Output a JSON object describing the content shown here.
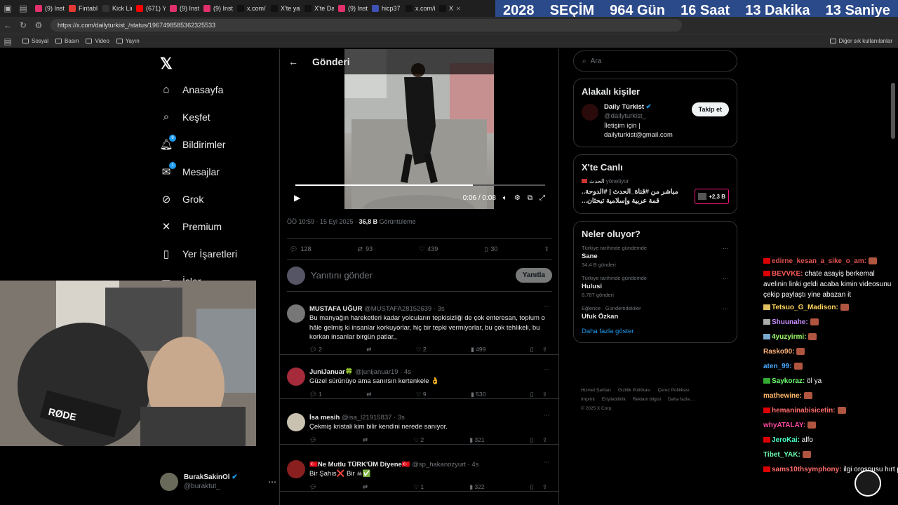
{
  "browser": {
    "tabs": [
      {
        "label": "(9) Inst",
        "color": "#e1306c"
      },
      {
        "label": "Fintabl",
        "color": "#e53935"
      },
      {
        "label": "Kick Lir",
        "color": "#333"
      },
      {
        "label": "(671) Y",
        "color": "#ff0000"
      },
      {
        "label": "(9) Inst",
        "color": "#e1306c"
      },
      {
        "label": "(9) Inst",
        "color": "#e1306c"
      },
      {
        "label": "x.com/",
        "color": "#111"
      },
      {
        "label": "X'te yal",
        "color": "#111"
      },
      {
        "label": "X'te Da",
        "color": "#111"
      },
      {
        "label": "(9) Inst",
        "color": "#e1306c"
      },
      {
        "label": "hicp37",
        "color": "#3f51b5"
      },
      {
        "label": "x.com/i",
        "color": "#111"
      },
      {
        "label": "X",
        "color": "#111"
      }
    ],
    "url": "https://x.com/dailyturkist_/status/1967498585362325533",
    "bookmarks": [
      "Sosyal",
      "Basın",
      "Video",
      "Yayın"
    ],
    "bookmarks_right": "Diğer sık kullanılanlar"
  },
  "banner": {
    "year": "2028",
    "label": "SEÇİM",
    "days": "964 Gün",
    "hours": "16 Saat",
    "minutes": "13 Dakika",
    "seconds": "13 Saniye"
  },
  "nav": {
    "items": [
      {
        "label": "Anasayfa",
        "icon": "home-icon",
        "glyph": "⌂"
      },
      {
        "label": "Keşfet",
        "icon": "search-icon",
        "glyph": "⌕"
      },
      {
        "label": "Bildirimler",
        "icon": "bell-icon",
        "glyph": "🔔︎",
        "badge": "9"
      },
      {
        "label": "Mesajlar",
        "icon": "mail-icon",
        "glyph": "✉",
        "badge": "1"
      },
      {
        "label": "Grok",
        "icon": "grok-icon",
        "glyph": "⊘"
      },
      {
        "label": "Premium",
        "icon": "x-icon",
        "glyph": "✕"
      },
      {
        "label": "Yer İşaretleri",
        "icon": "bookmark-icon",
        "glyph": "▯"
      },
      {
        "label": "İşler",
        "icon": "briefcase-icon",
        "glyph": "▭"
      }
    ]
  },
  "profile": {
    "name": "BurakSakinOl",
    "handle": "@buraktut_"
  },
  "post": {
    "header": "Gönderi",
    "time_current": "0:06",
    "time_total": "0:08",
    "timestamp": "ÖÖ 10:59 · 15 Eyl 2025 · ",
    "views": "36,8 B",
    "views_label": " Görüntüleme",
    "progress": 0.71,
    "stats": {
      "replies": "128",
      "reposts": "93",
      "likes": "439",
      "bookmarks": "30"
    },
    "reply_placeholder": "Yanıtını gönder",
    "reply_button": "Yanıtla"
  },
  "replies": [
    {
      "name": "MUSTAFA UĞUR",
      "handle": "@MUSTAFA28152639 · 3s",
      "text": "Bu manyağın hareketleri kadar yolcuların tepkisizliği de çok enteresan, toplum o  hâle gelmiş ki insanlar korkuyorlar, hiç bir tepki vermiyorlar, bu çok tehlikeli, bu korkan insanlar birgün patlar,,",
      "replies": "2",
      "reposts": "",
      "likes": "2",
      "views": "499",
      "avatar": "#777"
    },
    {
      "name": "JuniJanuar🍀",
      "handle": "@junijanuar19 · 4s",
      "text": "Güzel sürünüyo ama sanırsın kertenkele 👌",
      "replies": "1",
      "reposts": "",
      "likes": "9",
      "views": "530",
      "avatar": "#a52a3a"
    },
    {
      "name": "İsa mesih",
      "handle": "@isa_l21915837 · 3s",
      "text": "Çekmiş kristali kim bilir kendini nerede sanıyor.",
      "replies": "",
      "reposts": "",
      "likes": "2",
      "views": "321",
      "avatar": "#c9c2b0"
    },
    {
      "name": "🇹🇷Ne Mutlu TÜRK'ÜM Diyene🇹🇷",
      "handle": "@sp_hakanozyurt · 4s",
      "text": "Bir Şahıs❌ Bir ☠✅",
      "replies": "",
      "reposts": "",
      "likes": "1",
      "views": "322",
      "avatar": "#8a1f1f"
    }
  ],
  "sidebar": {
    "search_placeholder": "Ara",
    "related": {
      "title": "Alakalı kişiler",
      "name": "Daily Türkist",
      "handle": "@dailyturkist_",
      "bio": "İletişim için | dailyturkist@gmail.com",
      "follow": "Takip et"
    },
    "live": {
      "title": "X'te Canlı",
      "host": "الحدث",
      "host_suffix": "yönetiyor",
      "text": "مباشر من #قناة_الحدث | #الدوحة.. قمة عربية وإسلامية تبحثان...",
      "count": "+2,3 B"
    },
    "trends": {
      "title": "Neler oluyor?",
      "items": [
        {
          "category": "Türkiye tarihinde gündemde",
          "topic": "Sane",
          "count": "34,4 B gönderi"
        },
        {
          "category": "Türkiye tarihinde gündemde",
          "topic": "Hulusi",
          "count": "8.787 gönderi"
        },
        {
          "category": "Eğlence · Gündemdekiler",
          "topic": "Ufuk Özkan",
          "count": ""
        }
      ],
      "more": "Daha fazla göster"
    },
    "footer": [
      "Hizmet Şartları",
      "Gizlilik Politikası",
      "Çerez Politikası",
      "Imprint",
      "Erişilebilirlik",
      "Reklam bilgisi",
      "Daha fazla ...",
      "© 2025 X Corp."
    ]
  },
  "chat": [
    {
      "user": "edirne_kesan_a_sike_o_am:",
      "color": "#e05050",
      "text": "",
      "badge": "#d00"
    },
    {
      "user": "BEVVKE:",
      "color": "#ff5a5a",
      "text": " chate asayiş berkemal avelinin linki geldi acaba kimin videosunu çekip paylaştı yine abazan it",
      "badge": "#d00"
    },
    {
      "user": "Tetsuo_G_Madison:",
      "color": "#ffd75e",
      "text": "",
      "badge": "#e0c060"
    },
    {
      "user": "Shuunahe:",
      "color": "#c88dff",
      "text": "",
      "badge": "#aaa"
    },
    {
      "user": "4yuzyirmi:",
      "color": "#9cff6b",
      "text": "",
      "badge": "#7ac"
    },
    {
      "user": "Rasko90:",
      "color": "#ffb27a",
      "text": "",
      "badge": ""
    },
    {
      "user": "aten_99:",
      "color": "#4aa8ff",
      "text": "",
      "badge": ""
    },
    {
      "user": "Saykoraz:",
      "color": "#6dff6d",
      "text": " öl ya",
      "badge": "#3a3"
    },
    {
      "user": "mathewine:",
      "color": "#ffb86b",
      "text": "",
      "badge": ""
    },
    {
      "user": "hemaninabisicetin:",
      "color": "#ff6b6b",
      "text": "",
      "badge": "#d00"
    },
    {
      "user": "whyATALAY:",
      "color": "#ff4aa0",
      "text": "",
      "badge": ""
    },
    {
      "user": "JeroKai:",
      "color": "#4affc6",
      "text": " alfo",
      "badge": "#d00"
    },
    {
      "user": "Tibet_YAK:",
      "color": "#6dffb0",
      "text": "",
      "badge": ""
    },
    {
      "user": "sams10thsymphony:",
      "color": "#ff6b6b",
      "text": " ilgi orospusu hırt piçi",
      "badge": "#d00"
    }
  ]
}
